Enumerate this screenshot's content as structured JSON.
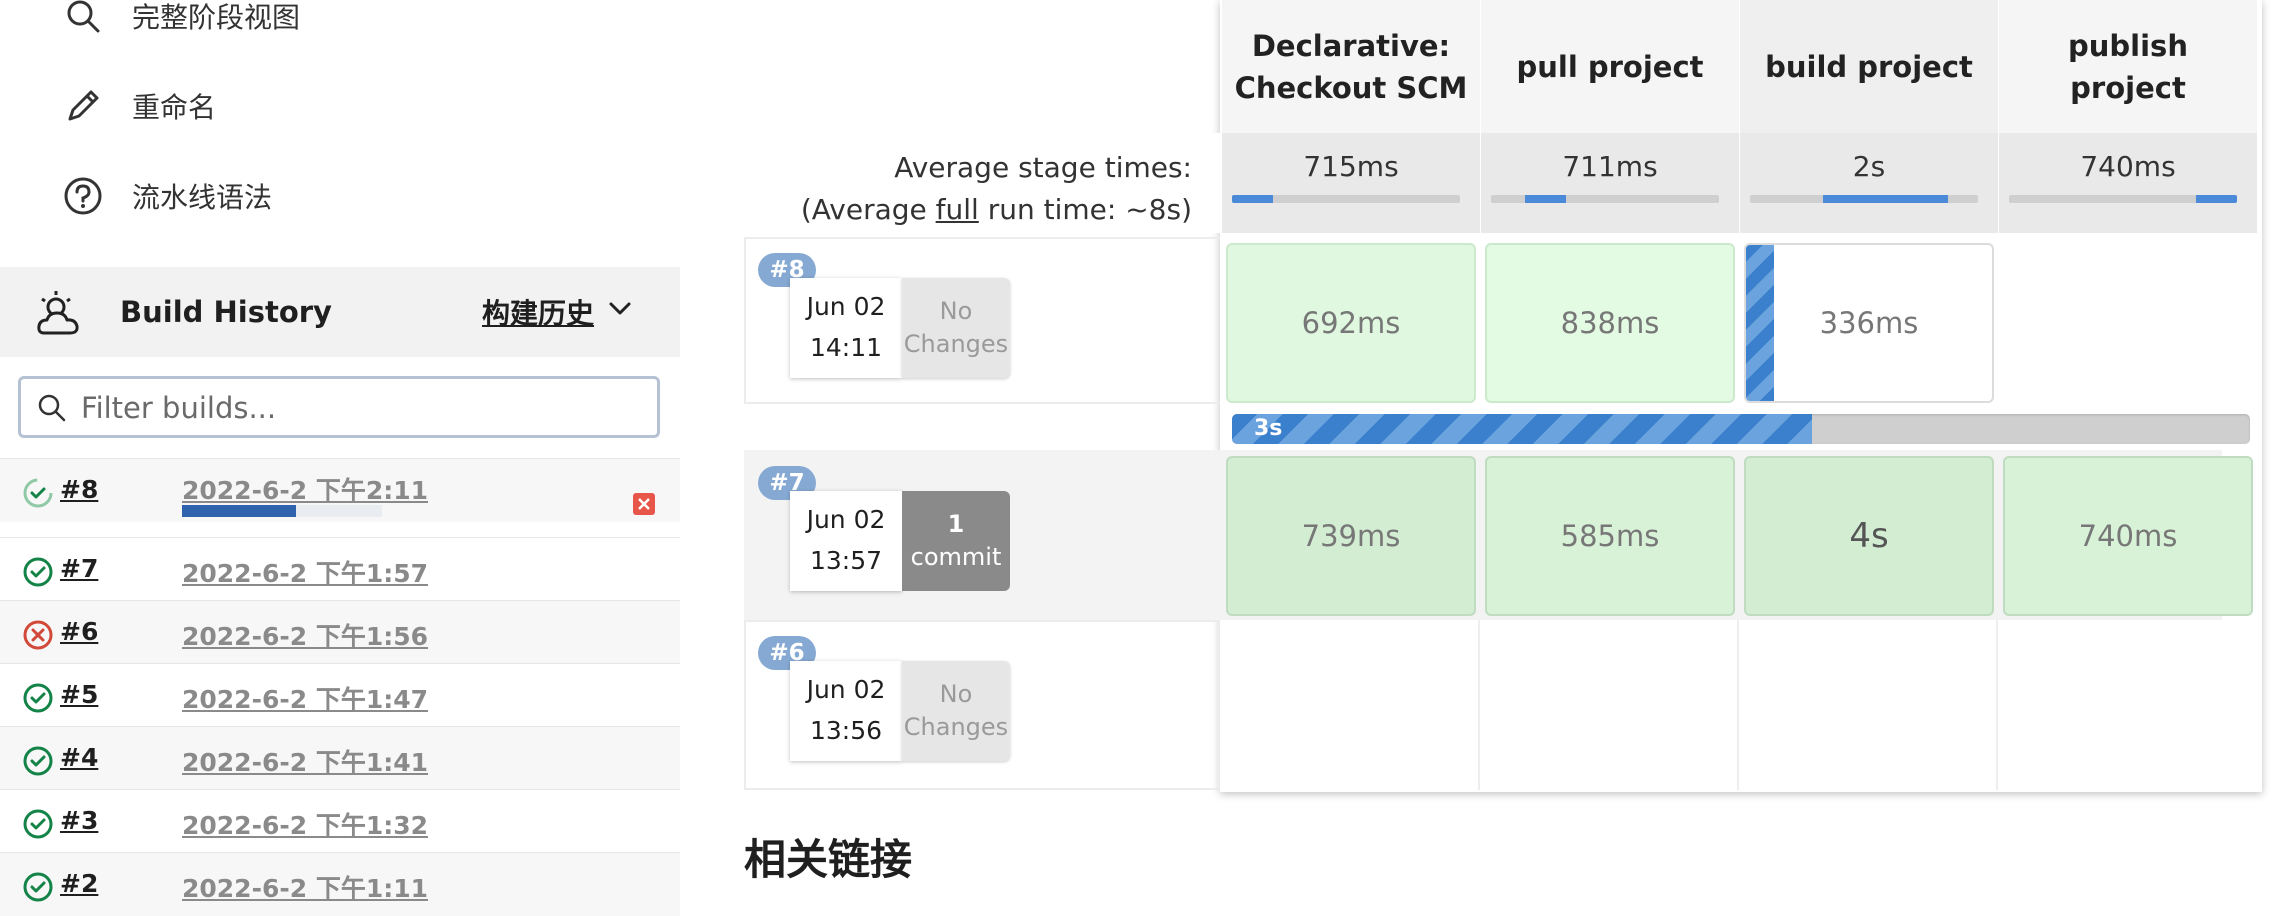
{
  "side_menu": {
    "items": [
      {
        "label": "完整阶段视图",
        "icon": "search-icon"
      },
      {
        "label": "重命名",
        "icon": "pencil-icon"
      },
      {
        "label": "流水线语法",
        "icon": "help-circle-icon"
      }
    ]
  },
  "build_history": {
    "title": "Build History",
    "trend_label": "构建历史",
    "filter_placeholder": "Filter builds...",
    "builds": [
      {
        "number": "#8",
        "date": "2022-6-2 下午2:11",
        "status": "in-progress",
        "progress": 0.57
      },
      {
        "number": "#7",
        "date": "2022-6-2 下午1:57",
        "status": "success"
      },
      {
        "number": "#6",
        "date": "2022-6-2 下午1:56",
        "status": "failed"
      },
      {
        "number": "#5",
        "date": "2022-6-2 下午1:47",
        "status": "success"
      },
      {
        "number": "#4",
        "date": "2022-6-2 下午1:41",
        "status": "success"
      },
      {
        "number": "#3",
        "date": "2022-6-2 下午1:32",
        "status": "success"
      },
      {
        "number": "#2",
        "date": "2022-6-2 下午1:11",
        "status": "success"
      }
    ]
  },
  "stage_view": {
    "stages": [
      {
        "name_line1": "Declarative:",
        "name_line2": "Checkout SCM",
        "avg": "715ms",
        "avg_start": 0.0,
        "avg_frac": 0.18
      },
      {
        "name_line1": "pull project",
        "name_line2": "",
        "avg": "711ms",
        "avg_start": 0.15,
        "avg_frac": 0.18
      },
      {
        "name_line1": "build project",
        "name_line2": "",
        "avg": "2s",
        "avg_start": 0.32,
        "avg_frac": 0.55
      },
      {
        "name_line1": "publish",
        "name_line2": "project",
        "avg": "740ms",
        "avg_start": 0.82,
        "avg_frac": 0.18
      }
    ],
    "avg_label_line1": "Average stage times:",
    "avg_label_prefix": "(Average ",
    "avg_label_full": "full",
    "avg_label_suffix": " run time: ~8s)",
    "runs": [
      {
        "badge": "#8",
        "date": "Jun 02",
        "time": "14:11",
        "changes_line1": "No",
        "changes_line2": "Changes",
        "stages": [
          "692ms",
          "838ms",
          "336ms",
          ""
        ]
      },
      {
        "badge": "#7",
        "date": "Jun 02",
        "time": "13:57",
        "changes_line1": "1",
        "changes_line2": "commit",
        "stages": [
          "739ms",
          "585ms",
          "4s",
          "740ms"
        ]
      },
      {
        "badge": "#6",
        "date": "Jun 02",
        "time": "13:56",
        "changes_line1": "No",
        "changes_line2": "Changes",
        "stages": [
          "",
          "",
          "",
          ""
        ]
      }
    ],
    "run_progress_label": "3s",
    "run_progress": 0.57
  },
  "related_links": {
    "title": "相关链接"
  },
  "colors": {
    "accent_blue": "#4a8ad8",
    "success_green": "#138347",
    "failure_red": "#d24939"
  }
}
